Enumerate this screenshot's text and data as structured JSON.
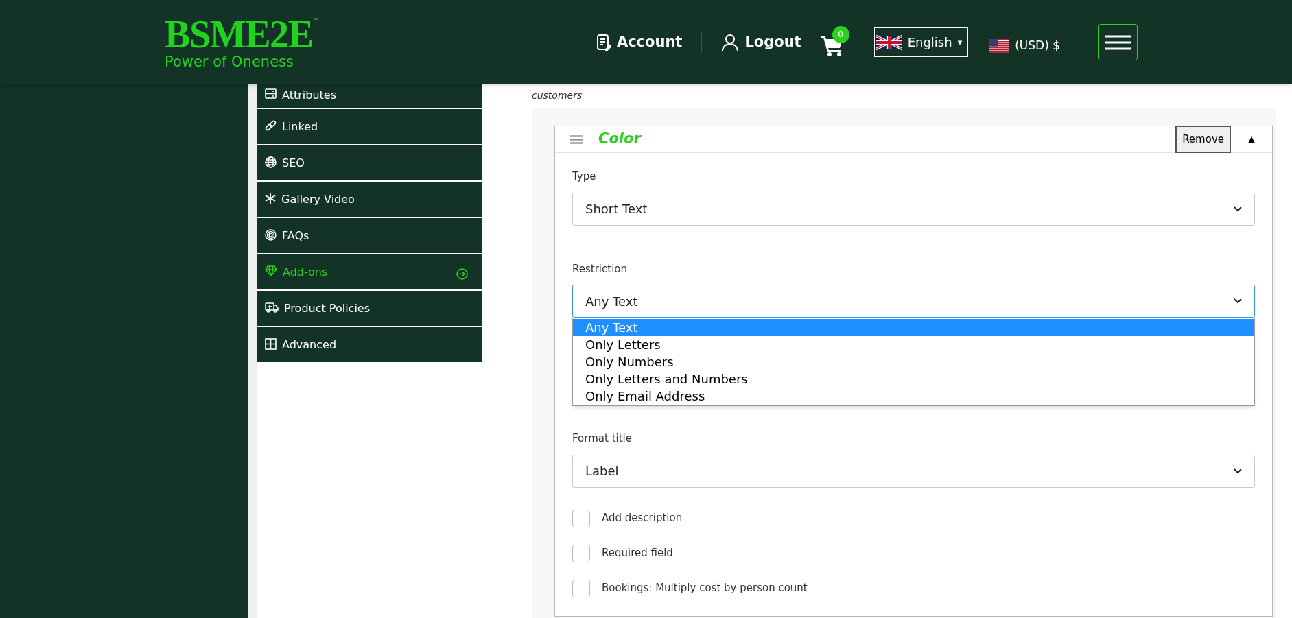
{
  "header": {
    "logo": {
      "name": "BSME2E",
      "trademark": "™",
      "tagline": "Power of Oneness"
    },
    "account": "Account",
    "logout": "Logout",
    "cart_count": "0",
    "language": {
      "label": "English",
      "caret": "▾"
    },
    "currency": "(USD) $"
  },
  "sidebar": {
    "items": [
      {
        "label": "Attributes",
        "selected": false
      },
      {
        "label": "Linked",
        "selected": false
      },
      {
        "label": "SEO",
        "selected": false
      },
      {
        "label": "Gallery Video",
        "selected": false
      },
      {
        "label": "FAQs",
        "selected": false
      },
      {
        "label": "Add-ons",
        "selected": true
      },
      {
        "label": "Product Policies",
        "selected": false
      },
      {
        "label": "Advanced",
        "selected": false
      }
    ]
  },
  "description": "customers",
  "addon": {
    "title": "Color",
    "remove": "Remove",
    "collapse": "▲",
    "fields": [
      {
        "label": "Type",
        "value": "Short Text",
        "focused": false
      },
      {
        "label": "Restriction",
        "value": "Any Text",
        "focused": true,
        "options": [
          {
            "label": "Any Text",
            "selected": true
          },
          {
            "label": "Only Letters",
            "selected": false
          },
          {
            "label": "Only Numbers",
            "selected": false
          },
          {
            "label": "Only Letters and Numbers",
            "selected": false
          },
          {
            "label": "Only Email Address",
            "selected": false
          }
        ]
      },
      {
        "label": "Format title",
        "value": "Label",
        "focused": false
      }
    ],
    "checkboxes": [
      {
        "label": "Add description",
        "checked": false
      },
      {
        "label": "Required field",
        "checked": false
      },
      {
        "label": "Bookings: Multiply cost by person count",
        "checked": false
      }
    ]
  }
}
